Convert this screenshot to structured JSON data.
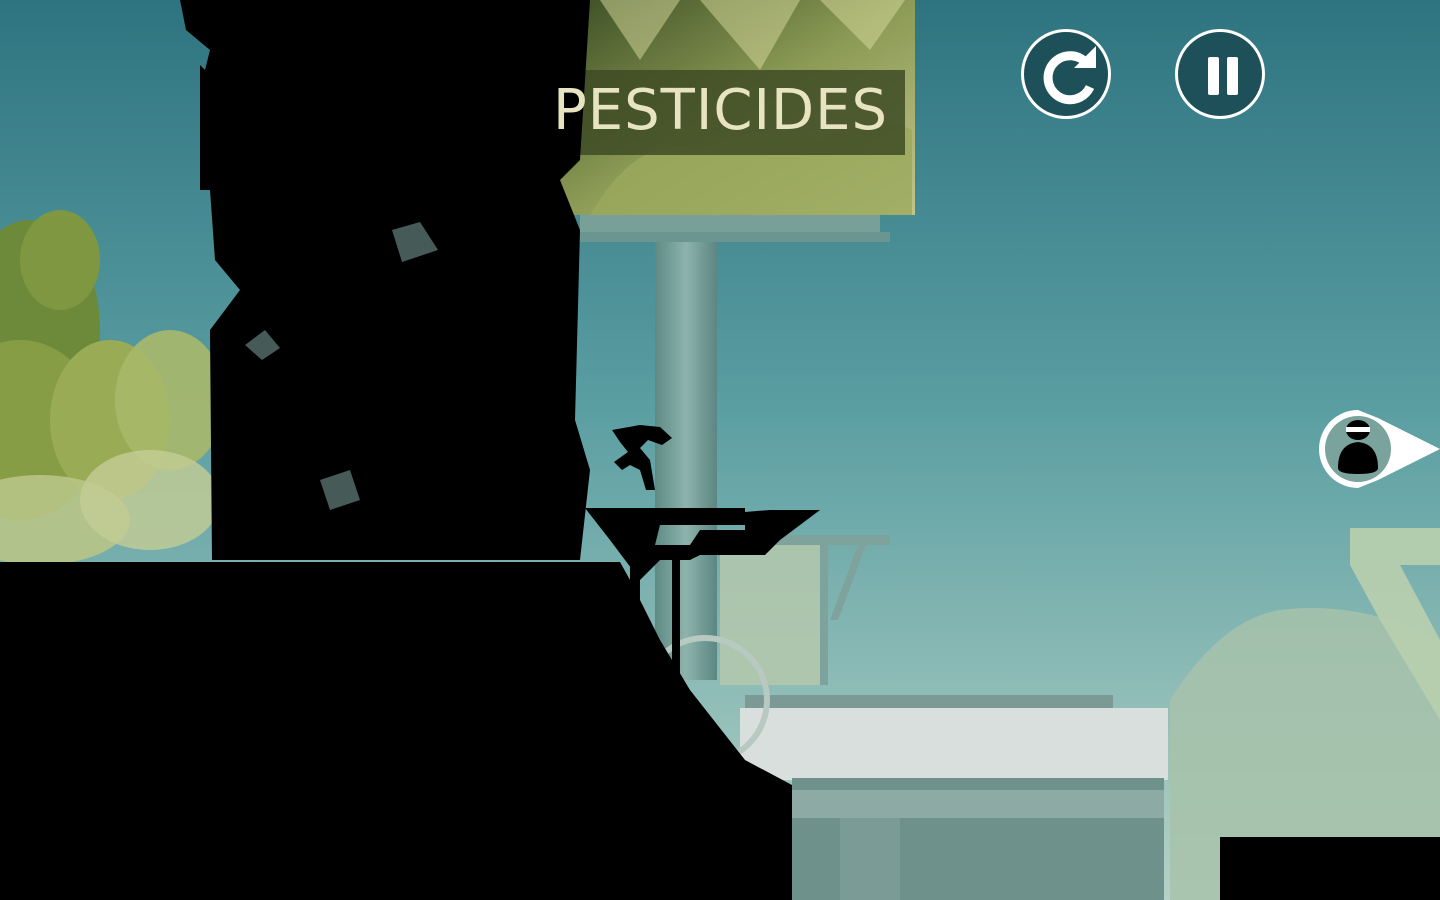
{
  "billboard": {
    "text": "PESTICIDES"
  },
  "hud": {
    "restart_icon": "restart-icon",
    "pause_icon": "pause-icon"
  },
  "indicator": {
    "icon": "pursuer-icon"
  },
  "colors": {
    "sky_top": "#2f7480",
    "sky_bottom": "#a9ccc4",
    "silhouette": "#000000",
    "hud_fill": "#1d5058",
    "hud_stroke": "#ffffff",
    "billboard_text": "#e8e3c0"
  }
}
